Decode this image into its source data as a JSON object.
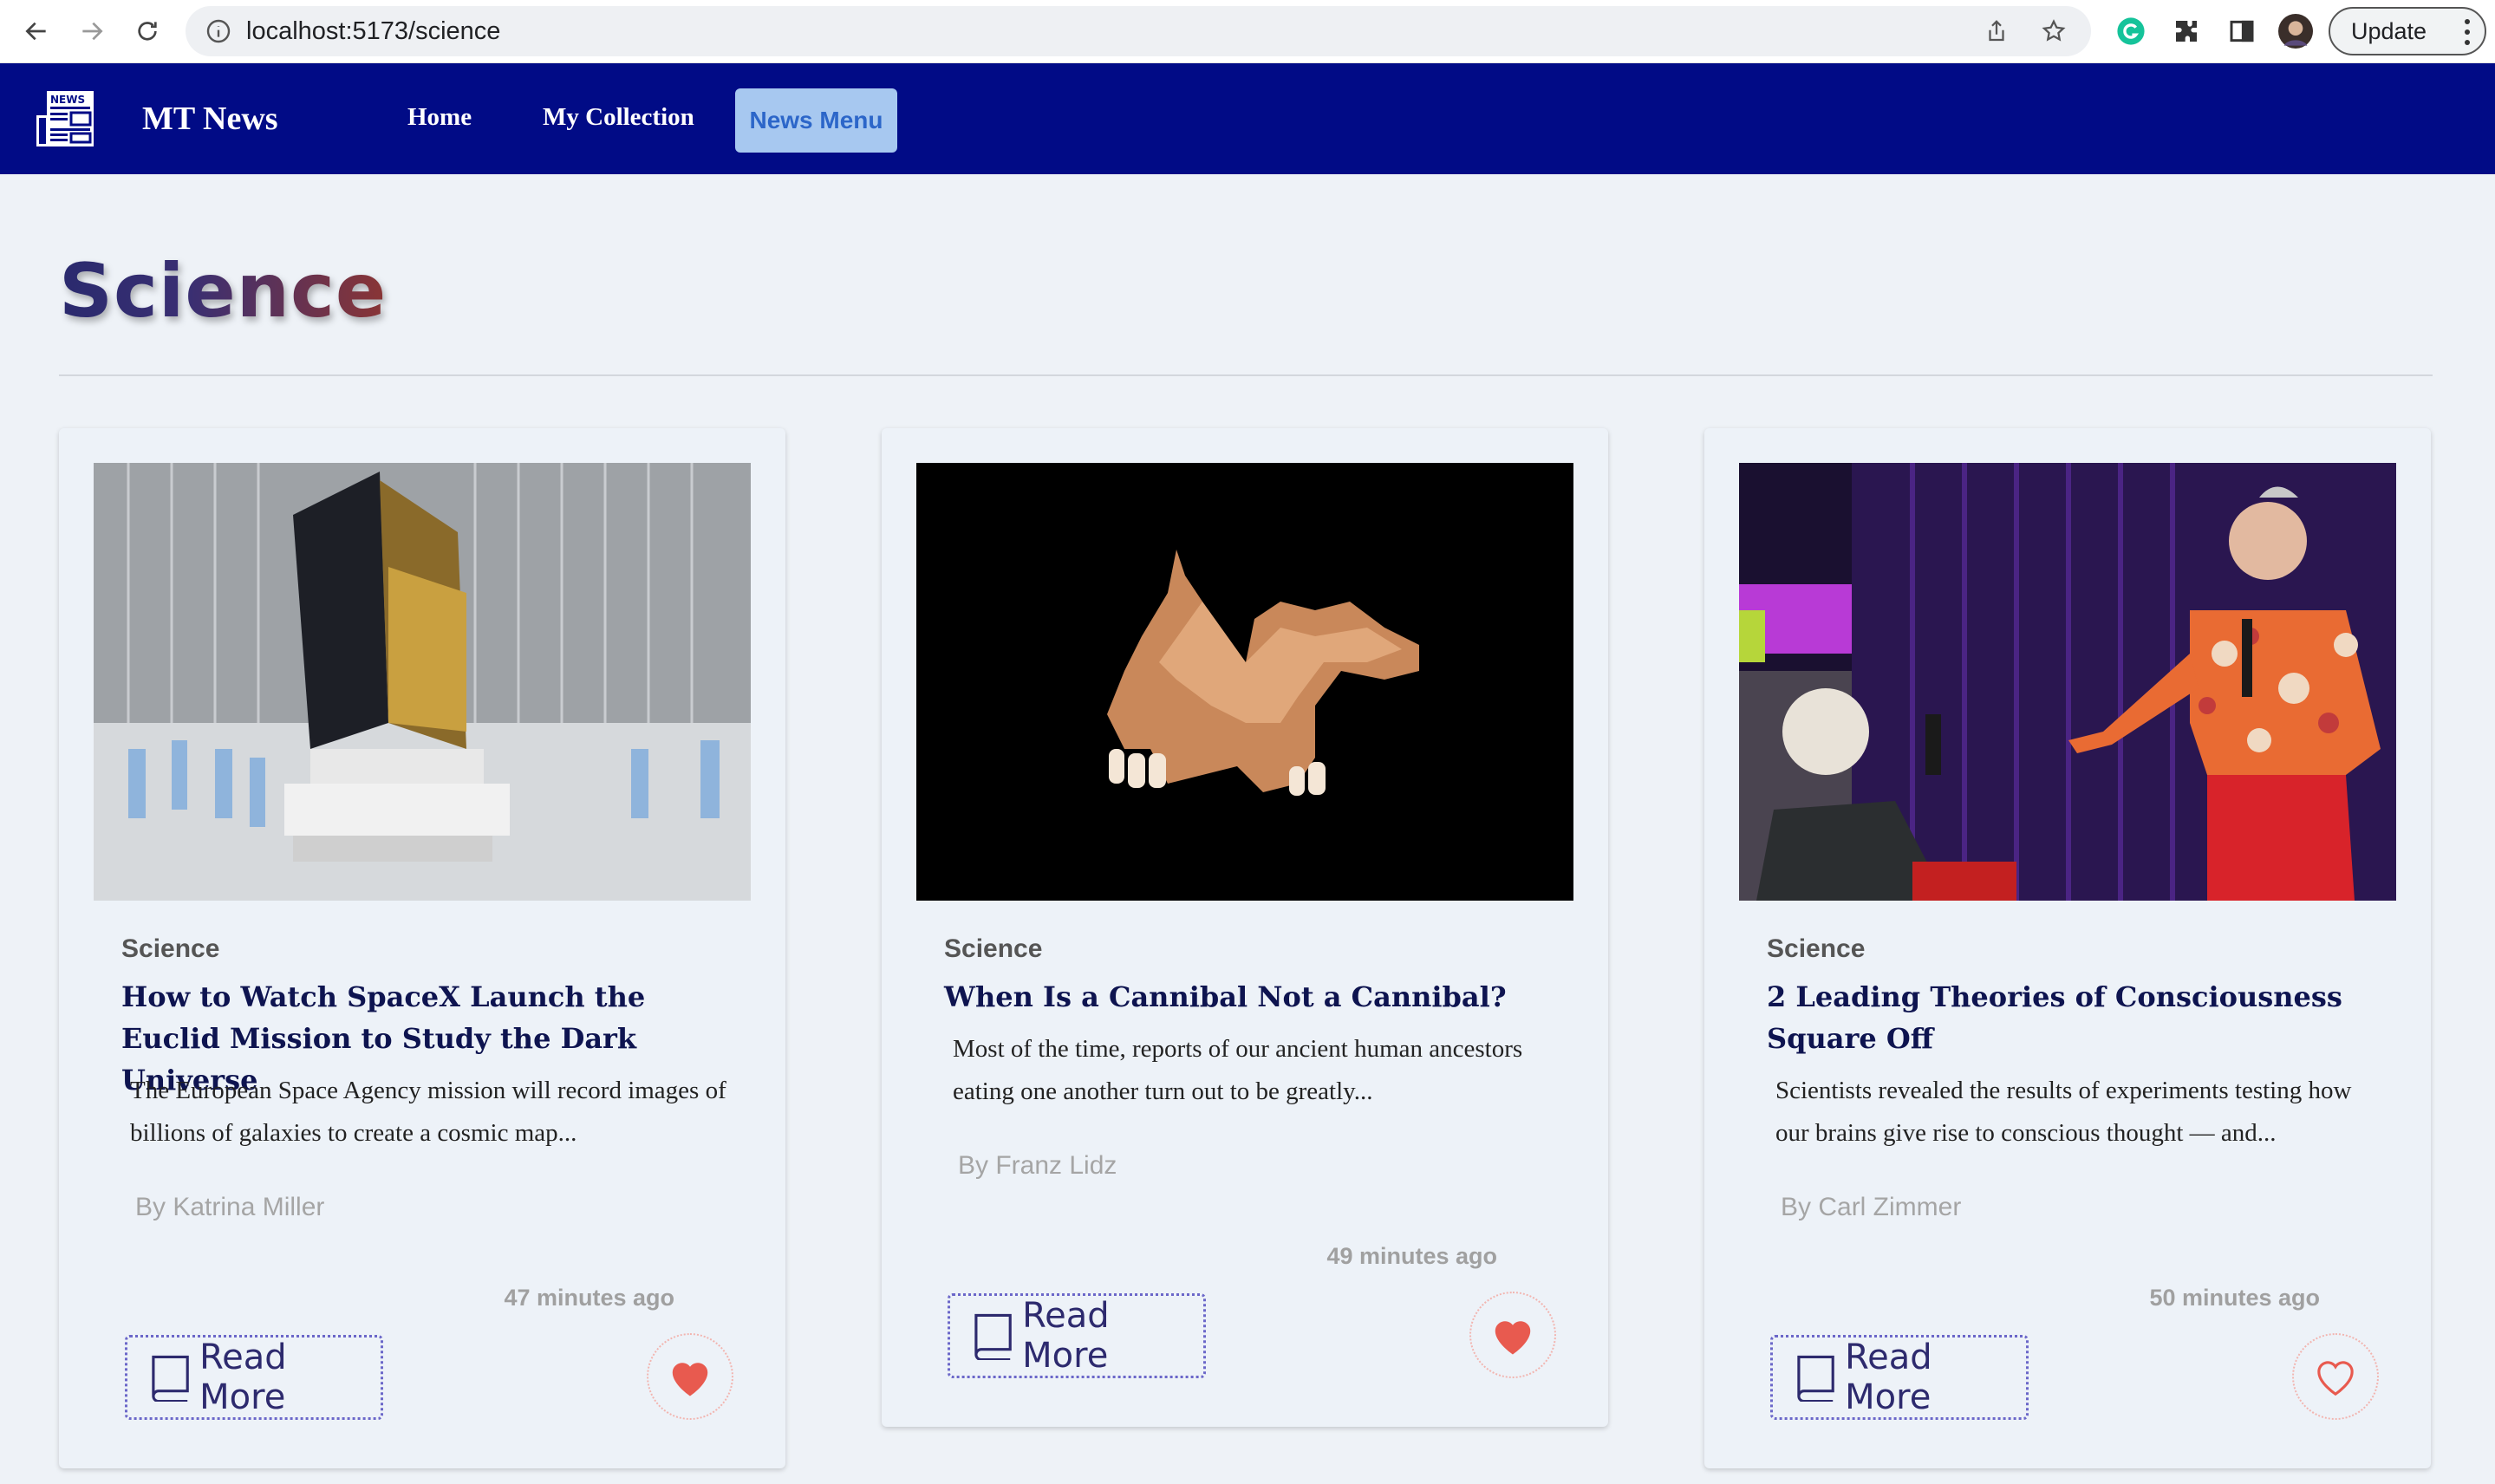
{
  "browser": {
    "url": "localhost:5173/science",
    "update_label": "Update"
  },
  "navbar": {
    "brand": "MT News",
    "links": [
      "Home",
      "My Collection"
    ],
    "menu_button": "News Menu"
  },
  "page": {
    "title": "Science"
  },
  "articles": [
    {
      "category": "Science",
      "title": "How to Watch SpaceX Launch the Euclid Mission to Study the Dark Universe",
      "description": "The European Space Agency mission will record images of billions of galaxies to create a cosmic map...",
      "author": "By Katrina Miller",
      "time": "47 minutes ago",
      "read_more": "Read More",
      "favorited": true
    },
    {
      "category": "Science",
      "title": "When Is a Cannibal Not a Cannibal?",
      "description": "Most of the time, reports of our ancient human ancestors eating one another turn out to be greatly...",
      "author": "By Franz Lidz",
      "time": "49 minutes ago",
      "read_more": "Read More",
      "favorited": true
    },
    {
      "category": "Science",
      "title": "2 Leading Theories of Consciousness Square Off",
      "description": "Scientists revealed the results of experiments testing how our brains give rise to conscious thought — and...",
      "author": "By Carl Zimmer",
      "time": "50 minutes ago",
      "read_more": "Read More",
      "favorited": false
    }
  ],
  "colors": {
    "navbar_bg": "#010b86",
    "menu_button_bg": "#a7c8f0",
    "heart": "#e85a4f"
  }
}
